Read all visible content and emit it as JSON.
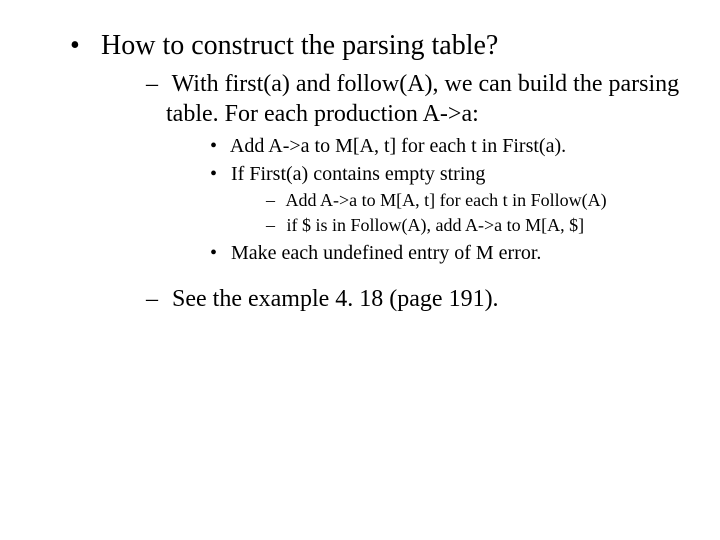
{
  "slide": {
    "bullet1": "How to construct the parsing table?",
    "sub1": "With first(a) and follow(A), we can build the parsing table. For each production A->a:",
    "sub1_item1": "Add A->a to M[A, t] for each t in First(a).",
    "sub1_item2": "If First(a) contains empty string",
    "sub1_item2_a": "Add A->a to M[A, t] for each t in Follow(A)",
    "sub1_item2_b": "if $ is in Follow(A), add A->a to M[A, $]",
    "sub1_item3": "Make each undefined entry of M error.",
    "sub2": "See the example 4. 18 (page 191)."
  }
}
